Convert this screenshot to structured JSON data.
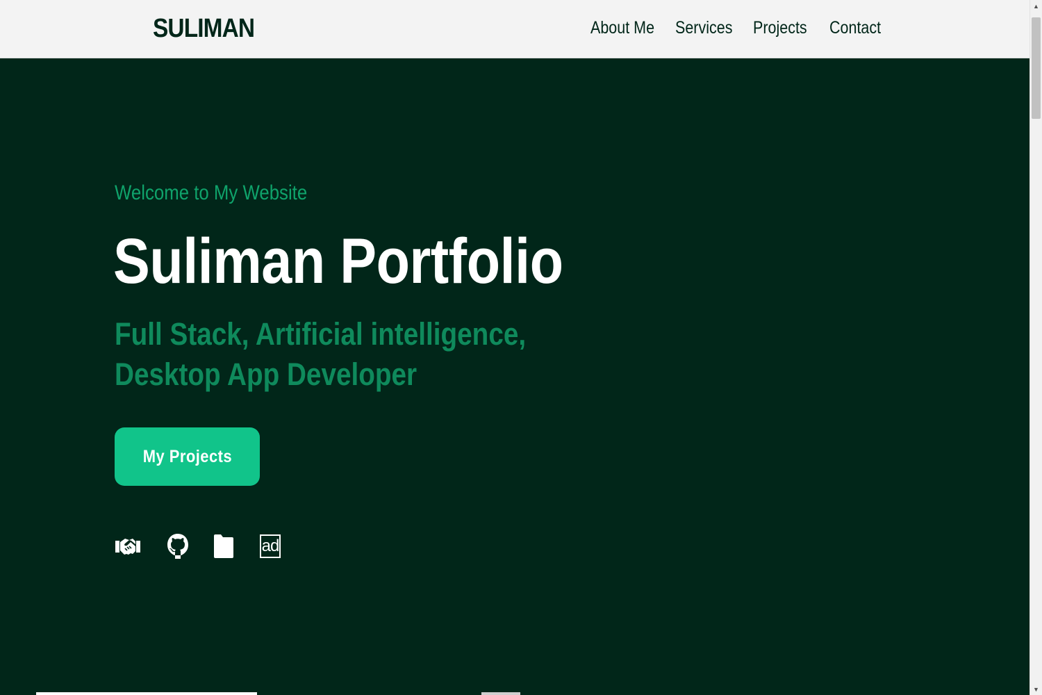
{
  "header": {
    "brand": "SULIMAN",
    "nav": [
      {
        "label": "About Me"
      },
      {
        "label": "Services"
      },
      {
        "label": "Projects"
      },
      {
        "label": "Contact"
      }
    ]
  },
  "hero": {
    "welcome": "Welcome to My Website",
    "title": "Suliman Portfolio",
    "subtitle_line1": "Full Stack, Artificial intelligence,",
    "subtitle_line2": "Desktop App Developer",
    "cta_label": "My Projects",
    "social_icon_4_text": "ad",
    "socials": [
      {
        "icon": "handshake-icon"
      },
      {
        "icon": "github-icon"
      },
      {
        "icon": "file-icon"
      },
      {
        "icon": "ad-icon"
      }
    ]
  },
  "colors": {
    "background": "#012619",
    "navbar": "#f3f3f3",
    "accent": "#11c48a",
    "accent_text": "#0fa36b",
    "subtitle": "#0f8a5c",
    "white": "#ffffff"
  }
}
